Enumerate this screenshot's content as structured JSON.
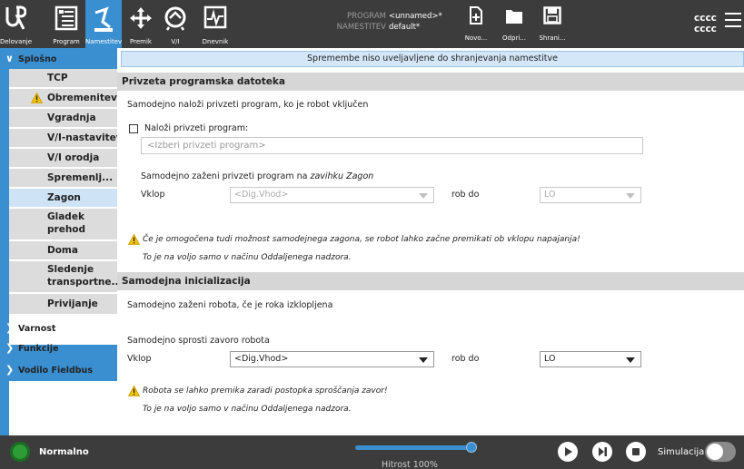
{
  "header": {
    "nav": [
      {
        "label": "Delovanje",
        "icon": "ur-logo-icon"
      },
      {
        "label": "Program",
        "icon": "program-icon"
      },
      {
        "label": "Namestitev",
        "icon": "installation-icon",
        "active": true
      },
      {
        "label": "Premik",
        "icon": "move-icon"
      },
      {
        "label": "V/I",
        "icon": "io-icon"
      },
      {
        "label": "Dnevnik",
        "icon": "log-icon"
      }
    ],
    "program_key": "PROGRAM",
    "program_value": "<unnamed>*",
    "installation_key": "NAMESTITEV",
    "installation_value": "default*",
    "file_actions": [
      {
        "label": "Novo...",
        "icon": "new-file-icon"
      },
      {
        "label": "Odpri...",
        "icon": "folder-icon"
      },
      {
        "label": "Shrani...",
        "icon": "save-icon"
      }
    ],
    "user_line1": "cccc",
    "user_line2": "cccc"
  },
  "sidebar": {
    "groups": [
      {
        "label": "Splošno",
        "expanded": true
      },
      {
        "label": "Varnost"
      },
      {
        "label": "Funkcije"
      },
      {
        "label": "Vodilo Fieldbus"
      }
    ],
    "items": [
      {
        "label": "TCP"
      },
      {
        "label": "Obremenitev",
        "warning": true
      },
      {
        "label": "Vgradnja"
      },
      {
        "label": "V/I-nastavitev"
      },
      {
        "label": "V/I orodja"
      },
      {
        "label": "Spremenlj..."
      },
      {
        "label": "Zagon",
        "active": true
      },
      {
        "label": "Gladek",
        "label2": "prehod"
      },
      {
        "label": "Doma"
      },
      {
        "label": "Sledenje",
        "label2": "transportne..."
      },
      {
        "label": "Privijanje"
      }
    ]
  },
  "content": {
    "notice": "Spremembe niso uveljavljene do shranjevanja namestitve",
    "section1": {
      "title": "Privzeta programska datoteka",
      "auto_load_text": "Samodejno naloži privzeti program, ko je robot vključen",
      "load_checkbox_label": "Naloži privzeti program:",
      "program_placeholder": "<Izberi privzeti program>",
      "auto_start_prefix": "Samodejno zaženi privzeti program na ",
      "auto_start_tab": "zavihku Zagon",
      "input_label": "Vklop",
      "input_value": "<Dig.Vhod>",
      "rob_label": "rob do",
      "edge_value": "LO",
      "warning_text": "Če je omogočena tudi možnost samodejnega zagona, se robot lahko začne premikati ob vklopu napajanja!",
      "remote_note": "To je na voljo samo v načinu Oddaljenega nadzora."
    },
    "section2": {
      "title": "Samodejna inicializacija",
      "auto_start_text": "Samodejno zaženi robota, če je roka izklopljena",
      "brake_text": "Samodejno sprosti zavoro robota",
      "input_label": "Vklop",
      "input_value": "<Dig.Vhod>",
      "rob_label": "rob do",
      "edge_value": "LO",
      "warning_text": "Robota se lahko premika zaradi postopka sproščanja zavor!",
      "remote_note": "To je na voljo samo v načinu Oddaljenega nadzora."
    }
  },
  "footer": {
    "status": "Normalno",
    "speed_label": "Hitrost 100%",
    "speed_fraction": 1.0,
    "simulation_label": "Simulacija",
    "simulation_on": false
  },
  "colors": {
    "accent": "#3a8fd1",
    "header": "#3c3c3c",
    "status_ok": "#2e9b36",
    "warning": "#f2c200"
  }
}
